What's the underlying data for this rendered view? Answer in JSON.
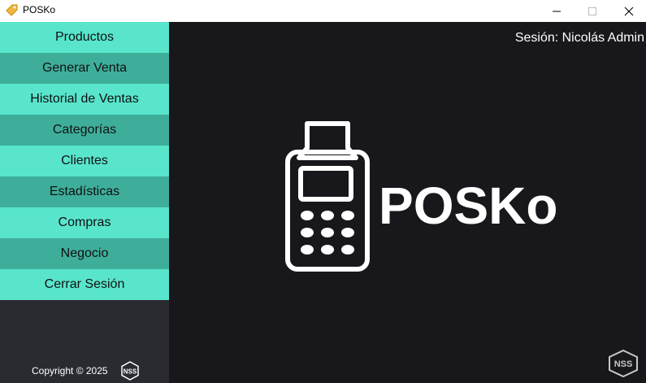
{
  "window": {
    "title": "POSKo"
  },
  "sidebar": {
    "items": [
      {
        "label": "Productos"
      },
      {
        "label": "Generar Venta"
      },
      {
        "label": "Historial de Ventas"
      },
      {
        "label": "Categorías"
      },
      {
        "label": "Clientes"
      },
      {
        "label": "Estadísticas"
      },
      {
        "label": "Compras"
      },
      {
        "label": "Negocio"
      },
      {
        "label": "Cerrar Sesión"
      }
    ],
    "copyright": "Copyright ©  2025",
    "footer_logo_text": "NSS"
  },
  "main": {
    "session_label": "Sesión: Nicolás Admin",
    "brand_text": "POSKo",
    "corner_logo_text": "NSS"
  },
  "colors": {
    "menu_light": "#58e5cc",
    "menu_dark": "#3eae9b",
    "sidebar_bg": "#2a2b31",
    "main_bg": "#17171c"
  }
}
